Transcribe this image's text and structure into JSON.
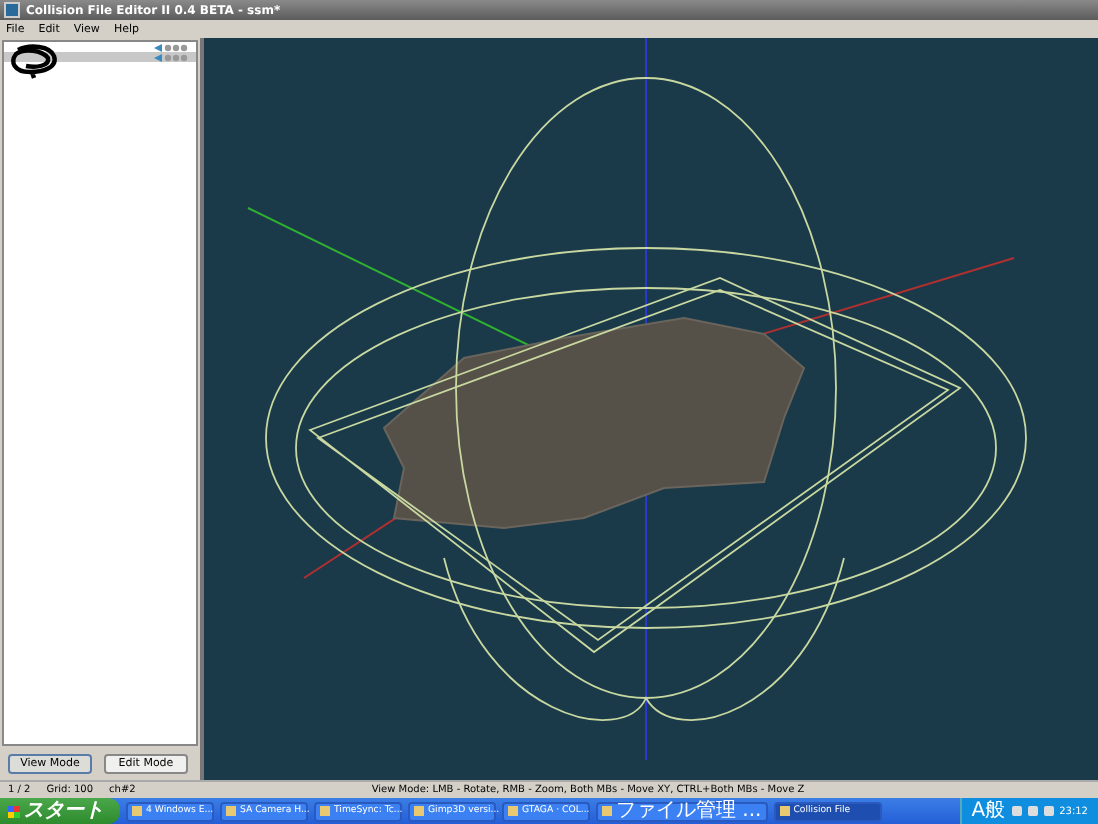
{
  "window": {
    "title": "Collision File Editor II 0.4 BETA - ssm*"
  },
  "menu": [
    "File",
    "Edit",
    "View",
    "Help"
  ],
  "tree": {
    "rows": [
      {
        "selected": false
      },
      {
        "selected": true
      }
    ]
  },
  "buttons": [
    {
      "label": "View Mode",
      "selected": true
    },
    {
      "label": "Edit Mode",
      "selected": false
    }
  ],
  "status_bar": {
    "page": "1 / 2",
    "grid": "Grid: 100",
    "channel": "ch#2",
    "hint": "View Mode: LMB - Rotate, RMB - Zoom, Both MBs - Move XY, CTRL+Both MBs - Move Z"
  },
  "taskbar": {
    "start": "スタート",
    "tasks": [
      {
        "label": "4 Windows E...",
        "selected": false
      },
      {
        "label": "SA Camera H...",
        "selected": false
      },
      {
        "label": "TimeSync: Tc...",
        "selected": false
      },
      {
        "label": "Gimp3D versi...",
        "selected": false
      },
      {
        "label": "GTAGA · COL...",
        "selected": false
      },
      {
        "label": "ファイル管理 ...",
        "selected": false
      },
      {
        "label": "Collision File",
        "selected": true
      }
    ],
    "tray_label": "A般",
    "clock": "23:12"
  }
}
